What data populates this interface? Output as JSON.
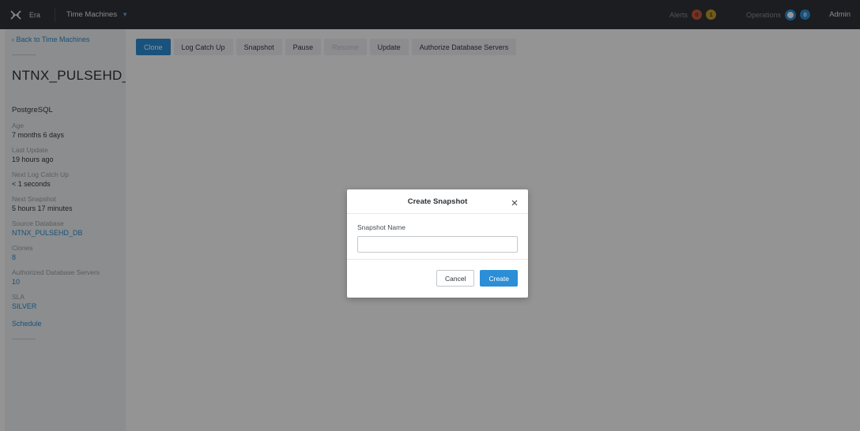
{
  "topbar": {
    "app_name": "Era",
    "section": "Time Machines",
    "alerts_label": "Alerts",
    "alerts_red": "0",
    "alerts_yellow": "1",
    "operations_label": "Operations",
    "operations_count": "0",
    "user": "Admin",
    "icons": {
      "logo": "era-logo-icon",
      "caret": "chevron-down-icon"
    }
  },
  "sidebar": {
    "back_link": "‹ Back to Time Machines",
    "name": "NTNX_PULSEHD_D...",
    "engine": "PostgreSQL",
    "properties": [
      {
        "label": "Age",
        "value": "7 months 6 days"
      },
      {
        "label": "Last Update",
        "value": "19 hours ago"
      },
      {
        "label": "Next Log Catch Up",
        "value": "< 1 seconds"
      },
      {
        "label": "Next Snapshot",
        "value": "5 hours 17 minutes"
      },
      {
        "label": "Source Database",
        "value": "NTNX_PULSEHD_DB"
      },
      {
        "label": "Clones",
        "value": "8"
      },
      {
        "label": "Authorized Database Servers",
        "value": "10"
      },
      {
        "label": "SLA",
        "value": "SILVER"
      }
    ],
    "schedule": "Schedule"
  },
  "toolbar": {
    "clone": "Clone",
    "log_catch_up": "Log Catch Up",
    "snapshot": "Snapshot",
    "pause": "Pause",
    "resume": "Resume",
    "update": "Update",
    "authorize": "Authorize Database Servers"
  },
  "modal": {
    "title": "Create Snapshot",
    "field_label": "Snapshot Name",
    "field_value": "",
    "cancel": "Cancel",
    "create": "Create",
    "close_icon": "close-icon"
  },
  "colors": {
    "accent": "#2b8ed6",
    "topbar": "#2f3338",
    "alert_red": "#c6553f",
    "alert_yellow": "#c29b2a"
  }
}
